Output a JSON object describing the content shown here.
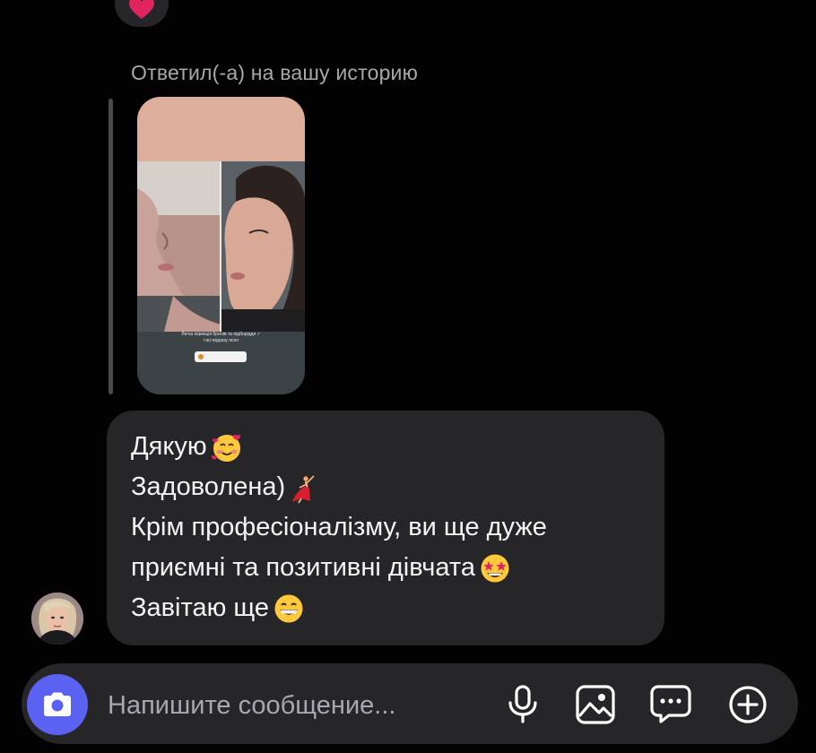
{
  "thread": {
    "top_reaction": {
      "icon": "heart-icon",
      "color": "#e0245e"
    },
    "reply_caption": "Ответил(-а) на вашу историю",
    "story_preview": {
      "caption_line1": "Легка корекція брилів та підборіддя ✓",
      "caption_line2": "і всі відразу ясно"
    }
  },
  "message": {
    "lines": [
      {
        "text": "Дякую",
        "emoji": "smiling-face-with-hearts-icon"
      },
      {
        "text": "Задоволена)",
        "emoji": "dancer-icon"
      },
      {
        "text": "Крім професіоналізму, ви ще дуже",
        "emoji": null
      },
      {
        "text": "приємні та позитивні дівчата",
        "emoji": "star-struck-icon"
      },
      {
        "text": "Завітаю ще",
        "emoji": "grinning-face-icon"
      }
    ]
  },
  "composer": {
    "placeholder": "Напишите сообщение...",
    "camera_color": "#5b62f2",
    "tools": [
      "microphone-icon",
      "image-icon",
      "chat-bubble-icon",
      "plus-icon"
    ]
  },
  "colors": {
    "background": "#020202",
    "bubble": "#262629",
    "secondary_text": "#a8a8a8"
  }
}
